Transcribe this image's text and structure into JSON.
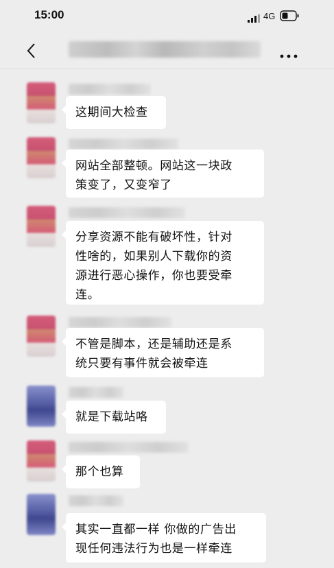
{
  "status_bar": {
    "time": "15:00",
    "network": "4G",
    "signal_icon": "signal-bars-icon",
    "battery_icon": "battery-icon"
  },
  "nav": {
    "back_icon": "chevron-left-icon",
    "more_icon": "more-dots-icon"
  },
  "messages": [
    {
      "text": "这期间大检查"
    },
    {
      "line1": "网站全部整顿。网站这一块政",
      "line2": "策变了，又变窄了"
    },
    {
      "line1": "分享资源不能有破坏性，针对",
      "line2": "性啥的，如果别人下载你的资",
      "line3": "源进行恶心操作，你也要受牵",
      "line4": "连。"
    },
    {
      "line1": "不管是脚本，还是辅助还是系",
      "line2": "统只要有事件就会被牵连"
    },
    {
      "text": "就是下载站咯"
    },
    {
      "text": "那个也算"
    },
    {
      "line1": "其实一直都一样 你做的广告出",
      "line2": "现任何违法行为也是一样牵连"
    }
  ]
}
